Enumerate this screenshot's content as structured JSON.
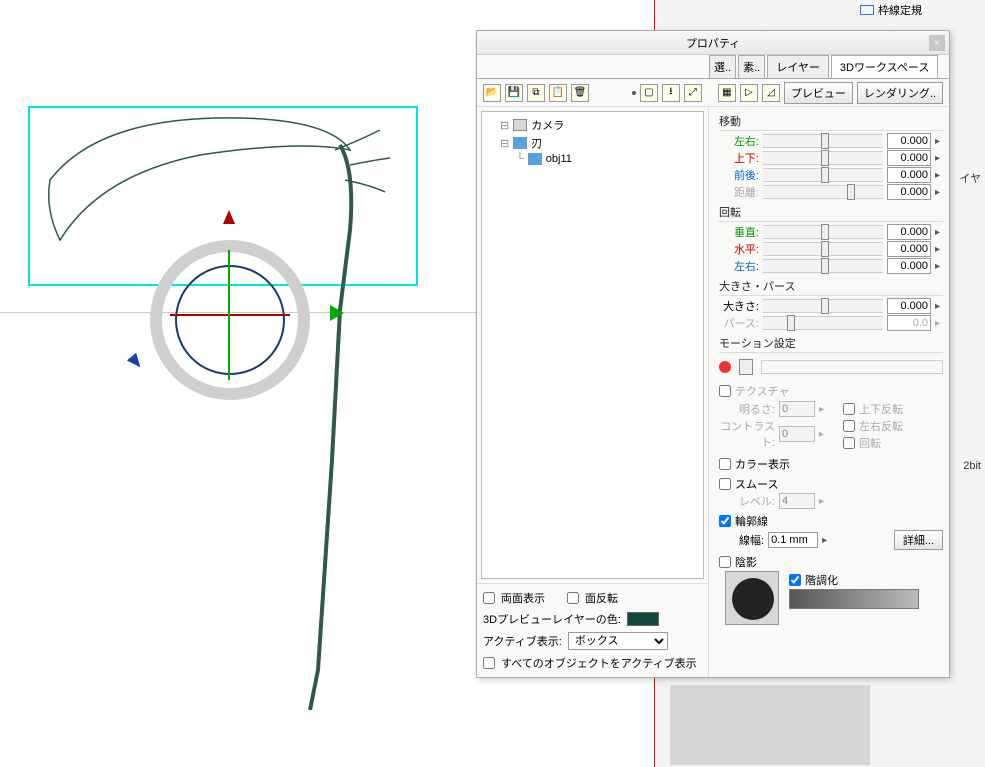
{
  "ruler_label": "枠線定規",
  "side_labels": {
    "layer": "イヤ",
    "bit": "2bit"
  },
  "panel": {
    "title": "プロパティ",
    "tabs": {
      "sel": "選..",
      "src": "素..",
      "layer": "レイヤー",
      "ws3d": "3Dワークスペース"
    },
    "toolbar": {
      "preview_btn": "プレビュー",
      "render_btn": "レンダリング.."
    },
    "tree": {
      "camera": "カメラ",
      "blade": "刃",
      "obj11": "obj11"
    },
    "left_bottom": {
      "both_faces": "両面表示",
      "face_flip": "面反転",
      "preview_layer_color": "3Dプレビューレイヤーの色:",
      "active_disp": "アクティブ表示:",
      "active_disp_value": "ボックス",
      "all_objects_active": "すべてのオブジェクトをアクティブ表示"
    },
    "props": {
      "move": {
        "header": "移動",
        "lr": "左右:",
        "ud": "上下:",
        "fb": "前後:",
        "dist": "距離:",
        "v_lr": "0.000",
        "v_ud": "0.000",
        "v_fb": "0.000",
        "v_dist": "0.000"
      },
      "rotate": {
        "header": "回転",
        "vert": "垂直:",
        "horiz": "水平:",
        "lr": "左右:",
        "v_vert": "0.000",
        "v_horiz": "0.000",
        "v_lr": "0.000"
      },
      "scale": {
        "header": "大きさ・パース",
        "size": "大きさ:",
        "pers": "パース:",
        "v_size": "0.000",
        "v_pers": "0.0"
      },
      "motion": {
        "header": "モーション設定"
      },
      "texture": {
        "header": "テクスチャ",
        "bright": "明るさ:",
        "contrast": "コントラスト:",
        "v_bright": "0",
        "v_contrast": "0",
        "flip_ud": "上下反転",
        "flip_lr": "左右反転",
        "rot": "回転"
      },
      "color_disp": "カラー表示",
      "smooth": {
        "header": "スムース",
        "level": "レベル:",
        "value": "4"
      },
      "outline": {
        "header": "輪郭線",
        "line_w": "線幅:",
        "value": "0.1 mm",
        "detail": "詳細..."
      },
      "shadow": {
        "header": "陰影",
        "tone": "階調化"
      }
    }
  },
  "chart_data": {
    "type": "table",
    "title": "3D transform properties",
    "series": [
      {
        "name": "移動",
        "values": {
          "左右": 0.0,
          "上下": 0.0,
          "前後": 0.0,
          "距離": 0.0
        }
      },
      {
        "name": "回転",
        "values": {
          "垂直": 0.0,
          "水平": 0.0,
          "左右": 0.0
        }
      },
      {
        "name": "大きさ・パース",
        "values": {
          "大きさ": 0.0,
          "パース": 0.0
        }
      }
    ]
  }
}
